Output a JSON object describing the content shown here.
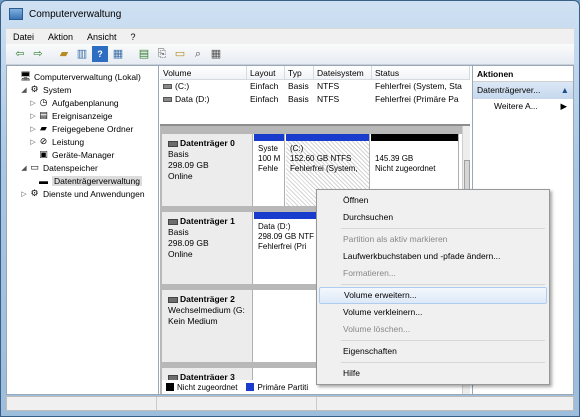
{
  "window": {
    "title": "Computerverwaltung"
  },
  "menu": [
    "Datei",
    "Aktion",
    "Ansicht",
    "?"
  ],
  "tree": [
    {
      "label": "Computerverwaltung (Lokal)",
      "indent": 0,
      "exp": "",
      "icon": "computer-icon",
      "glyph": "🖥"
    },
    {
      "label": "System",
      "indent": 1,
      "exp": "◢",
      "icon": "tools-icon",
      "glyph": "⚙"
    },
    {
      "label": "Aufgabenplanung",
      "indent": 2,
      "exp": "▷",
      "icon": "clock-icon",
      "glyph": "◷"
    },
    {
      "label": "Ereignisanzeige",
      "indent": 2,
      "exp": "▷",
      "icon": "event-viewer-icon",
      "glyph": "▤"
    },
    {
      "label": "Freigegebene Ordner",
      "indent": 2,
      "exp": "▷",
      "icon": "shared-folder-icon",
      "glyph": "▰"
    },
    {
      "label": "Leistung",
      "indent": 2,
      "exp": "▷",
      "icon": "performance-icon",
      "glyph": "⊘"
    },
    {
      "label": "Geräte-Manager",
      "indent": 2,
      "exp": "",
      "icon": "device-manager-icon",
      "glyph": "▣"
    },
    {
      "label": "Datenspeicher",
      "indent": 1,
      "exp": "◢",
      "icon": "storage-icon",
      "glyph": "▭"
    },
    {
      "label": "Datenträgerverwaltung",
      "indent": 2,
      "exp": "",
      "icon": "disk-management-icon",
      "glyph": "▬",
      "selected": true
    },
    {
      "label": "Dienste und Anwendungen",
      "indent": 1,
      "exp": "▷",
      "icon": "services-icon",
      "glyph": "⚙"
    }
  ],
  "volumes": {
    "headers": [
      "Volume",
      "Layout",
      "Typ",
      "Dateisystem",
      "Status"
    ],
    "rows": [
      [
        "(C:)",
        "Einfach",
        "Basis",
        "NTFS",
        "Fehlerfrei (System, Sta"
      ],
      [
        "Data (D:)",
        "Einfach",
        "Basis",
        "NTFS",
        "Fehlerfrei (Primäre Pa"
      ]
    ]
  },
  "disks": [
    {
      "name": "Datenträger 0",
      "lines": [
        "Basis",
        "298.09 GB",
        "Online"
      ],
      "parts": [
        {
          "lines": [
            "Syste",
            "100 M",
            "Fehle"
          ],
          "color": "#1a3ccc",
          "hatch": false
        },
        {
          "lines": [
            "(C:)",
            "152.60 GB NTFS",
            "Fehlerfrei (System,"
          ],
          "color": "#1a3ccc",
          "hatch": true
        },
        {
          "lines": [
            "",
            "145.39 GB",
            "Nicht zugeordnet"
          ],
          "color": "#000000",
          "hatch": false
        }
      ]
    },
    {
      "name": "Datenträger 1",
      "lines": [
        "Basis",
        "298.09 GB",
        "Online"
      ],
      "parts": [
        {
          "lines": [
            "Data (D:)",
            "298.09 GB NTF",
            "Fehlerfrei (Pri"
          ],
          "color": "#1a3ccc",
          "hatch": false
        }
      ]
    },
    {
      "name": "Datenträger 2",
      "lines": [
        "Wechselmedium (G:",
        "",
        "Kein Medium"
      ],
      "parts": []
    },
    {
      "name": "Datenträger 3",
      "lines": [],
      "parts": []
    }
  ],
  "legend": [
    {
      "label": "Nicht zugeordnet",
      "color": "#000000"
    },
    {
      "label": "Primäre Partiti",
      "color": "#1a3ccc"
    }
  ],
  "actions": {
    "header": "Aktionen",
    "sub": "Datenträgerver...",
    "items": [
      "Weitere A..."
    ]
  },
  "context_menu": [
    {
      "label": "Öffnen",
      "state": "enabled"
    },
    {
      "label": "Durchsuchen",
      "state": "enabled"
    },
    {
      "sep": true
    },
    {
      "label": "Partition als aktiv markieren",
      "state": "disabled"
    },
    {
      "label": "Laufwerkbuchstaben und -pfade ändern...",
      "state": "enabled"
    },
    {
      "label": "Formatieren...",
      "state": "disabled"
    },
    {
      "sep": true
    },
    {
      "label": "Volume erweitern...",
      "state": "highlighted"
    },
    {
      "label": "Volume verkleinern...",
      "state": "enabled"
    },
    {
      "label": "Volume löschen...",
      "state": "disabled"
    },
    {
      "sep": true
    },
    {
      "label": "Eigenschaften",
      "state": "enabled"
    },
    {
      "sep": true
    },
    {
      "label": "Hilfe",
      "state": "enabled"
    }
  ]
}
